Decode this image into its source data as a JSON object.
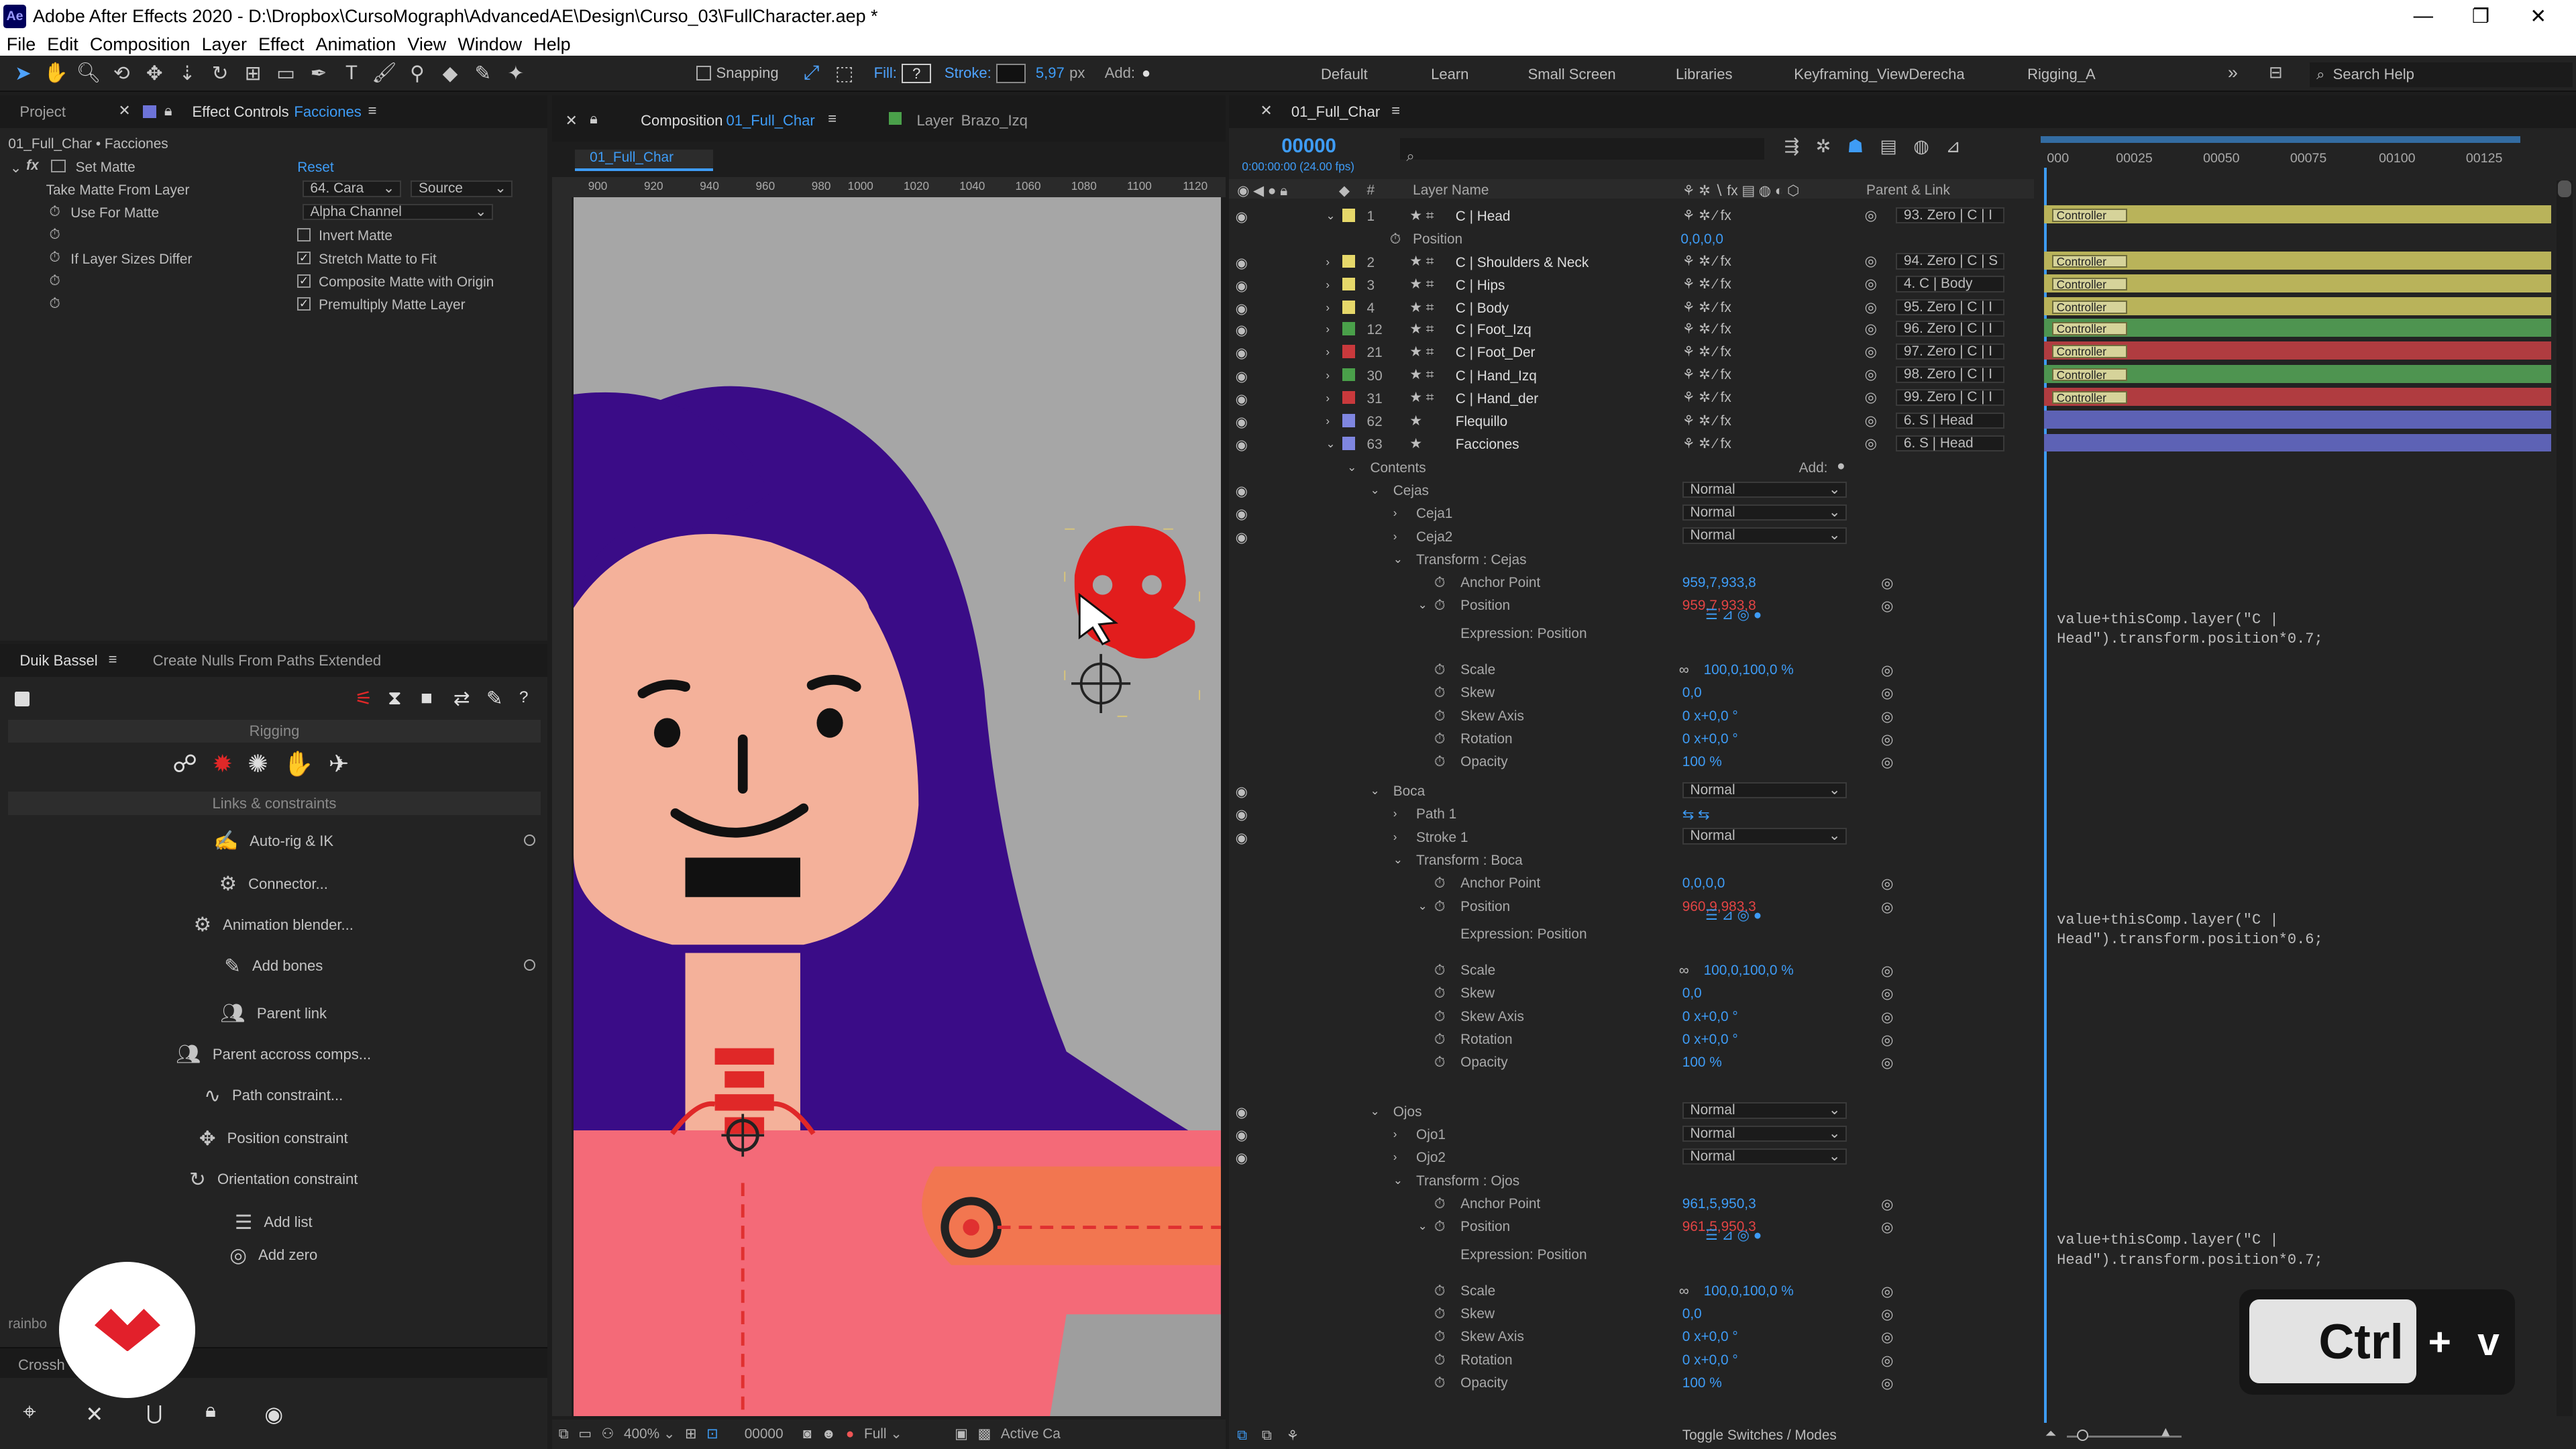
{
  "window": {
    "app_icon": "Ae",
    "title": "Adobe After Effects 2020 - D:\\Dropbox\\CursoMograph\\AdvancedAE\\Design\\Curso_03\\FullCharacter.aep *"
  },
  "menu": [
    "File",
    "Edit",
    "Composition",
    "Layer",
    "Effect",
    "Animation",
    "View",
    "Window",
    "Help"
  ],
  "toolbar": {
    "snapping_label": "Snapping",
    "fill_label": "Fill:",
    "stroke_label": "Stroke:",
    "stroke_width": "5,97",
    "stroke_unit": "px",
    "add_label": "Add:",
    "search_placeholder": "Search Help"
  },
  "workspaces": [
    "Default",
    "Learn",
    "Small Screen",
    "Libraries",
    "Keyframing_ViewDerecha",
    "Rigging_A"
  ],
  "left_panel": {
    "tab_project": "Project",
    "tab_effect_controls": "Effect Controls",
    "tab_effect_controls_layer": "Facciones",
    "breadcrumb": "01_Full_Char • Facciones",
    "effect_name": "Set Matte",
    "reset": "Reset",
    "props": [
      {
        "label": "Take Matte From Layer",
        "value": "64. Cara",
        "value2": "Source"
      },
      {
        "label": "Use For Matte",
        "value": "Alpha Channel"
      },
      {
        "label": "",
        "check": "Invert Matte",
        "checked": false
      },
      {
        "label": "If Layer Sizes Differ",
        "check": "Stretch Matte to Fit",
        "checked": true
      },
      {
        "label": "",
        "check": "Composite Matte with Origin",
        "checked": true
      },
      {
        "label": "",
        "check": "Premultiply Matte Layer",
        "checked": true
      }
    ]
  },
  "duik": {
    "tab1": "Duik Bassel",
    "tab2": "Create Nulls From Paths Extended",
    "section_rigging": "Rigging",
    "section_links": "Links & constraints",
    "items": [
      "Auto-rig & IK",
      "Connector...",
      "Animation blender...",
      "Add bones",
      "Parent link",
      "Parent accross comps...",
      "Path constraint...",
      "Position constraint",
      "Orientation constraint",
      "Add list",
      "Add zero"
    ],
    "footer_text": "rainbo",
    "crosshair_tab": "Crossh"
  },
  "composition": {
    "tab_label": "Composition",
    "tab_name": "01_Full_Char",
    "layer_tab": "Layer",
    "layer_name": "Brazo_Izq",
    "breadcrumb": "01_Full_Char",
    "ruler": [
      "900",
      "920",
      "940",
      "960",
      "980",
      "1000",
      "1020",
      "1040",
      "1060",
      "1080",
      "1100",
      "1120"
    ],
    "zoom": "400%",
    "timecode": "00000",
    "resolution": "Full",
    "camera": "Active Ca"
  },
  "timeline": {
    "tab": "01_Full_Char",
    "timecode": "00000",
    "fps": "0:00:00:00 (24.00 fps)",
    "col_layer_name": "Layer Name",
    "col_parent": "Parent & Link",
    "ruler": [
      "000",
      "00025",
      "00050",
      "00075",
      "00100",
      "00125"
    ],
    "layers": [
      {
        "num": "1",
        "name": "C | Head",
        "parent": "93. Zero | C | I",
        "color": "#e6d86a",
        "bar": "#b9b35a",
        "ctrl": "Controller"
      },
      {
        "num": "2",
        "name": "C | Shoulders & Neck",
        "parent": "94. Zero | C | S",
        "color": "#e6d86a",
        "bar": "#b9b35a",
        "ctrl": "Controller"
      },
      {
        "num": "3",
        "name": "C | Hips",
        "parent": "4. C | Body",
        "color": "#e6d86a",
        "bar": "#b9b35a",
        "ctrl": "Controller"
      },
      {
        "num": "4",
        "name": "C | Body",
        "parent": "95. Zero | C | I",
        "color": "#e6d86a",
        "bar": "#b9b35a",
        "ctrl": "Controller"
      },
      {
        "num": "12",
        "name": "C | Foot_Izq",
        "parent": "96. Zero | C | I",
        "color": "#4aa04a",
        "bar": "#4e9450",
        "ctrl": "Controller"
      },
      {
        "num": "21",
        "name": "C | Foot_Der",
        "parent": "97. Zero | C | I",
        "color": "#c9393c",
        "bar": "#b03c40",
        "ctrl": "Controller"
      },
      {
        "num": "30",
        "name": "C | Hand_Izq",
        "parent": "98. Zero | C | I",
        "color": "#4aa04a",
        "bar": "#4e9450",
        "ctrl": "Controller"
      },
      {
        "num": "31",
        "name": "C | Hand_der",
        "parent": "99. Zero | C | I",
        "color": "#c9393c",
        "bar": "#b03c40",
        "ctrl": "Controller"
      },
      {
        "num": "62",
        "name": "Flequillo",
        "parent": "6. S | Head",
        "color": "#7f86e0",
        "bar": "#5d62b5",
        "ctrl": ""
      },
      {
        "num": "63",
        "name": "Facciones",
        "parent": "6. S | Head",
        "color": "#7f86e0",
        "bar": "#5d62b5",
        "ctrl": ""
      }
    ],
    "head_position_label": "Position",
    "head_position_value": "0,0,0,0",
    "contents_label": "Contents",
    "add_label": "Add:",
    "groups": [
      {
        "name": "Cejas",
        "mode": "Normal",
        "children": [
          {
            "name": "Ceja1",
            "mode": "Normal"
          },
          {
            "name": "Ceja2",
            "mode": "Normal"
          }
        ],
        "transform": "Transform : Cejas",
        "anchor": "959,7,933,8",
        "position": "959,7,933,8",
        "expr_label": "Expression: Position",
        "scale": "100,0,100,0 %",
        "skew": "0,0",
        "skew_axis": "0 x+0,0 °",
        "rotation": "0 x+0,0 °",
        "opacity": "100 %",
        "expression": "value+thisComp.layer(\"C |\nHead\").transform.position*0.7;"
      },
      {
        "name": "Boca",
        "mode": "Normal",
        "children": [
          {
            "name": "Path 1",
            "mode": ""
          },
          {
            "name": "Stroke 1",
            "mode": "Normal"
          }
        ],
        "transform": "Transform : Boca",
        "anchor": "0,0,0,0",
        "position": "960,9,983,3",
        "expr_label": "Expression: Position",
        "scale": "100,0,100,0 %",
        "skew": "0,0",
        "skew_axis": "0 x+0,0 °",
        "rotation": "0 x+0,0 °",
        "opacity": "100 %",
        "expression": "value+thisComp.layer(\"C |\nHead\").transform.position*0.6;"
      },
      {
        "name": "Ojos",
        "mode": "Normal",
        "children": [
          {
            "name": "Ojo1",
            "mode": "Normal"
          },
          {
            "name": "Ojo2",
            "mode": "Normal"
          }
        ],
        "transform": "Transform : Ojos",
        "anchor": "961,5,950,3",
        "position": "961,5,950,3",
        "expr_label": "Expression: Position",
        "scale": "100,0,100,0 %",
        "skew": "0,0",
        "skew_axis": "0 x+0,0 °",
        "rotation": "0 x+0,0 °",
        "opacity": "100 %",
        "expression": "value+thisComp.layer(\"C |\nHead\").transform.position*0.7;"
      }
    ],
    "prop_labels": {
      "anchor": "Anchor Point",
      "position": "Position",
      "scale": "Scale",
      "skew": "Skew",
      "skew_axis": "Skew Axis",
      "rotation": "Rotation",
      "opacity": "Opacity"
    },
    "footer_toggle": "Toggle Switches / Modes"
  },
  "shortcut_overlay": {
    "key": "Ctrl",
    "plus": "+",
    "key2": "v"
  }
}
